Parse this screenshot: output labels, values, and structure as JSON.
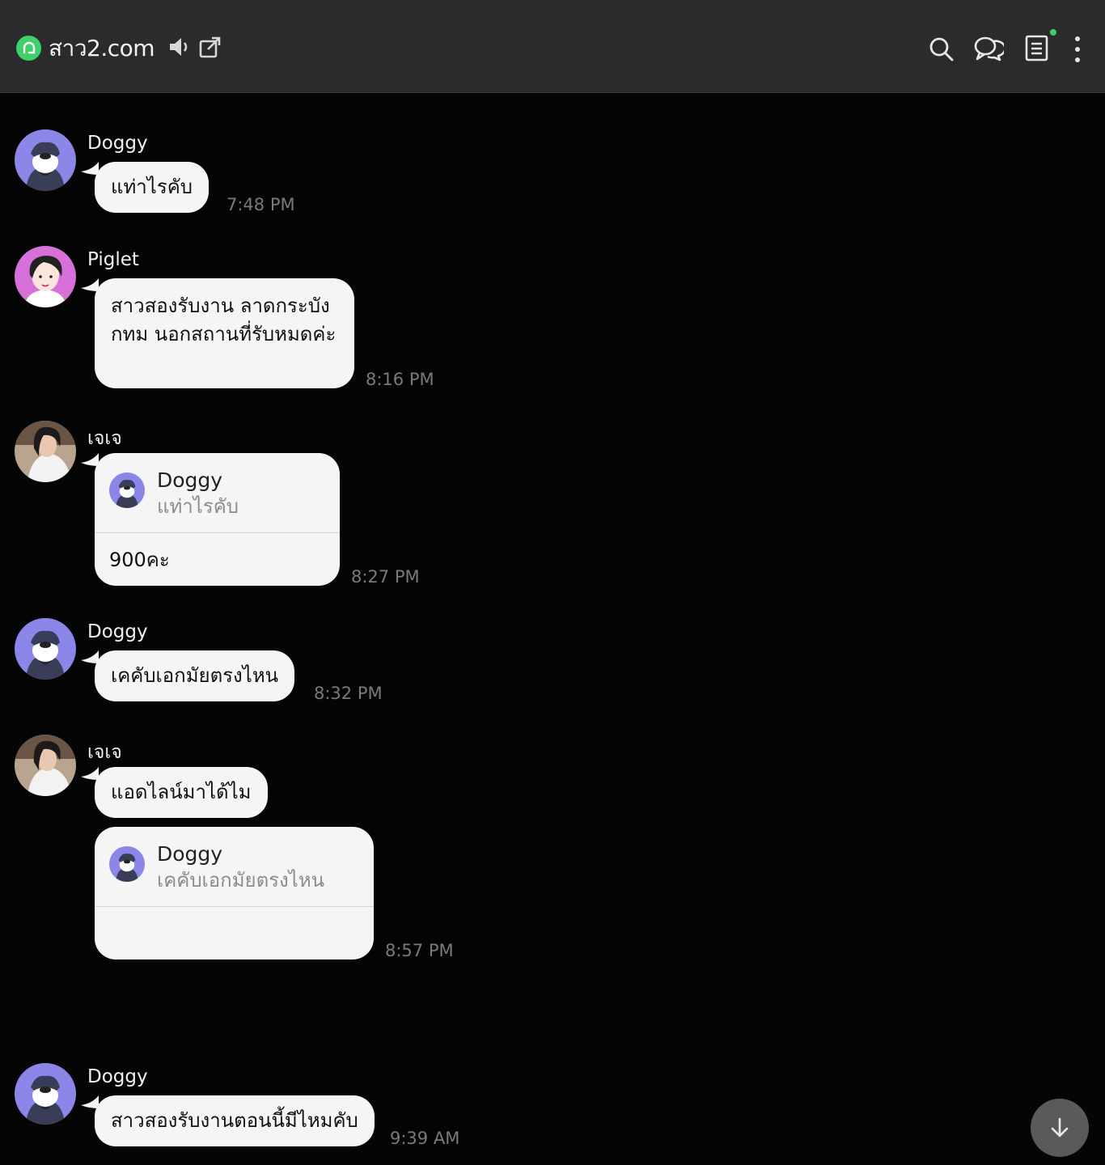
{
  "header": {
    "title": "สาว2.com",
    "icons": [
      "mute-icon",
      "popout-icon",
      "search-icon",
      "chats-icon",
      "notes-icon",
      "more-icon"
    ],
    "accent": "#3fd06a"
  },
  "messages": [
    {
      "sender": "Doggy",
      "text": "แท่าไรคับ",
      "time": "7:48 PM"
    },
    {
      "sender": "Piglet",
      "lines": [
        "สาวสองรับงาน ลาดกระบัง",
        "กทม นอกสถานที่รับหมดค่ะ"
      ],
      "time": "8:16 PM"
    },
    {
      "sender": "เจเจ",
      "reply_to": {
        "name": "Doggy",
        "text": "แท่าไรคับ"
      },
      "text": "900คะ",
      "time": "8:27 PM"
    },
    {
      "sender": "Doggy",
      "text": "เคคับเอกมัยตรงไหน",
      "time": "8:32 PM"
    },
    {
      "sender": "เจเจ",
      "text": "แอดไลน์มาได้ไม"
    },
    {
      "reply_to": {
        "name": "Doggy",
        "text": "เคคับเอกมัยตรงไหน"
      },
      "time": "8:57 PM"
    },
    {
      "sender": "Doggy",
      "text": "สาวสองรับงานตอนนี้มีไหมคับ",
      "time": "9:39 AM"
    }
  ]
}
